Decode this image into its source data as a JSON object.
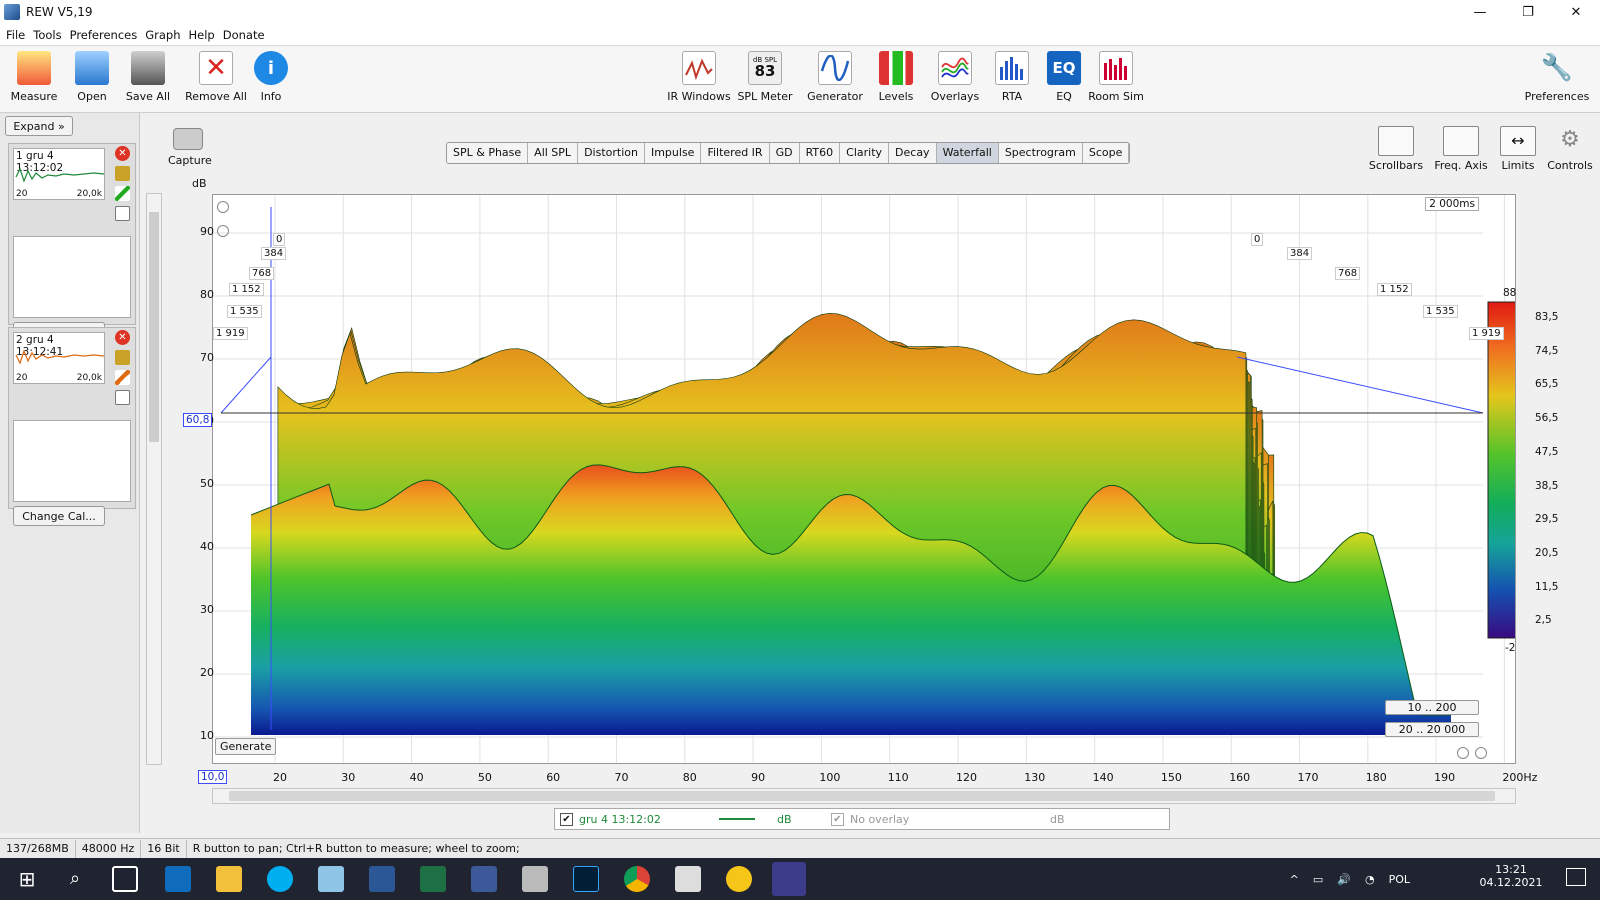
{
  "window": {
    "title": "REW V5,19",
    "minimize": "—",
    "maximize": "❐",
    "close": "✕"
  },
  "menu": [
    "File",
    "Tools",
    "Preferences",
    "Graph",
    "Help",
    "Donate"
  ],
  "toolbar": {
    "left": [
      "Measure",
      "Open",
      "Save All",
      "Remove All",
      "Info"
    ],
    "center": [
      "IR Windows",
      "SPL Meter",
      "Generator",
      "Levels",
      "Overlays",
      "RTA",
      "EQ",
      "Room Sim"
    ],
    "right": [
      "Preferences"
    ],
    "spl_meter_value": "83",
    "spl_meter_unit": "dB SPL",
    "eq_icon_text": "EQ"
  },
  "left_panel": {
    "expand_label": "Expand",
    "measurements": [
      {
        "index": "1",
        "name": "gru 4 13:12:02",
        "low": "20",
        "high": "20,0k",
        "color": "#1f8a3a",
        "cal_label": "Change Cal..."
      },
      {
        "index": "2",
        "name": "gru 4 13:12:41",
        "low": "20",
        "high": "20,0k",
        "color": "#e06a10",
        "cal_label": "Change Cal..."
      }
    ]
  },
  "capture_label": "Capture",
  "graph_tabs": [
    "SPL & Phase",
    "All SPL",
    "Distortion",
    "Impulse",
    "Filtered IR",
    "GD",
    "RT60",
    "Clarity",
    "Decay",
    "Waterfall",
    "Spectrogram",
    "Scope"
  ],
  "active_tab": "Waterfall",
  "right_controls": [
    "Scrollbars",
    "Freq. Axis",
    "Limits",
    "Controls"
  ],
  "graph": {
    "y_unit": "dB",
    "y_ticks": [
      "90",
      "80",
      "70",
      "60",
      "50",
      "40",
      "30",
      "20",
      "10"
    ],
    "x_ticks": [
      "20",
      "30",
      "40",
      "50",
      "60",
      "70",
      "80",
      "90",
      "100",
      "110",
      "120",
      "130",
      "140",
      "150",
      "160",
      "170",
      "180",
      "190",
      "200Hz"
    ],
    "x_cursor": "10,0",
    "y_cursor": "60,8",
    "time_label": "2 000ms",
    "time_ticks_left": [
      "0",
      "384",
      "768",
      "1 152",
      "1 535",
      "1 919"
    ],
    "time_ticks_right": [
      "0",
      "384",
      "768",
      "1 152",
      "1 535",
      "1 919"
    ],
    "colorbar_top": "88",
    "colorbar_ticks": [
      "83,5",
      "74,5",
      "65,5",
      "56,5",
      "47,5",
      "38,5",
      "29,5",
      "20,5",
      "11,5",
      "2,5"
    ],
    "colorbar_bottom": "-2",
    "generate_label": "Generate",
    "range_1": "10 .. 200",
    "range_2": "20 .. 20 000"
  },
  "legend": {
    "name": "gru 4 13:12:02",
    "unit": "dB",
    "overlay": "No overlay",
    "overlay_unit": "dB",
    "line_color": "#1f8a3a"
  },
  "status": {
    "memory": "137/268MB",
    "rate": "48000 Hz",
    "bits": "16 Bit",
    "hint": "R button to pan; Ctrl+R button to measure; wheel to zoom;"
  },
  "taskbar": {
    "lang": "POL",
    "time": "13:21",
    "date": "04.12.2021"
  }
}
